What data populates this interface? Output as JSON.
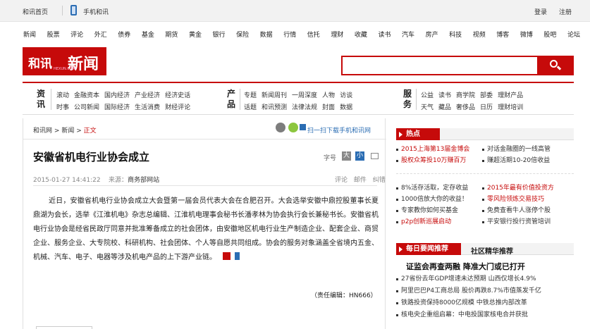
{
  "topbar": {
    "home": "和讯首页",
    "mobile": "手机和讯",
    "login": "登录",
    "register": "注册"
  },
  "nav": [
    "新闻",
    "股票",
    "评论",
    "外汇",
    "债券",
    "基金",
    "期货",
    "黄金",
    "银行",
    "保险",
    "数据",
    "行情",
    "信托",
    "理财",
    "收藏",
    "读书",
    "汽车",
    "房产",
    "科技",
    "视频",
    "博客",
    "微博",
    "股吧",
    "论坛"
  ],
  "logo": {
    "brand": "和讯",
    "channel": "新闻",
    "domain": "HEXUN.COM"
  },
  "search": {
    "value": "",
    "placeholder": ""
  },
  "channels": {
    "info": {
      "label": "资讯",
      "row1": [
        "滚动",
        "金融资本",
        "国内经济",
        "产业经济",
        "经济史话"
      ],
      "row2": [
        "时事",
        "公司新闻",
        "国际经济",
        "生活消费",
        "财经评论"
      ]
    },
    "product": {
      "label": "产品",
      "row1": [
        "专题",
        "新闻周刊",
        "一周深度",
        "人物",
        "访谈"
      ],
      "row2": [
        "话题",
        "和讯预测",
        "法律法规",
        "封面",
        "数据"
      ]
    },
    "service": {
      "label": "服务",
      "row1": [
        "公益",
        "读书",
        "商学院",
        "部委",
        "理财产品"
      ],
      "row2": [
        "天气",
        "藏品",
        "奢侈品",
        "日历",
        "理财培训"
      ]
    }
  },
  "breadcrumb": {
    "site": "和讯网",
    "section": "新闻",
    "current": "正文",
    "sep1": ">",
    "sep2": ">"
  },
  "qr_text": "扫一扫下载手机和讯网",
  "article": {
    "title": "安徽省机电行业协会成立",
    "font_label": "字号",
    "font_big": "大",
    "font_small": "小",
    "date": "2015-01-27 14:41:22",
    "source_label": "来源：",
    "source": "商务部网站",
    "comment": "评论",
    "mail": "邮件",
    "error": "纠错",
    "body": "近日，安徽省机电行业协会成立大会暨第一届会员代表大会在合肥召开。大会选举安徽中鼎控股董事长夏鼎湖为会长，选举《江淮机电》杂志总编辑、江淮机电理事会秘书长潘孝林为协会执行会长兼秘书长。安徽省机电行业协会是经省民政厅同意并批准筹备成立的社会团体，由安徽地区机电行业生产制造企业、配套企业、商贸企业、服务企业、大专院校、科研机构、社会团体、个人等自愿共同组成。协会的服务对象涵盖全省境内五金、机械、汽车、电子、电器等涉及机电产品的上下游产业链。",
    "editor": "（责任编辑：HN666）"
  },
  "sidebar": {
    "hot_title": "热点",
    "hot": [
      {
        "left": "2015上海第13届金博会",
        "left_red": true,
        "right": "对话金融圈的一线高管",
        "right_red": false
      },
      {
        "left": "股权众筹投10万赚百万",
        "left_red": true,
        "right": "赚超活期10-20倍收益",
        "right_red": false
      }
    ],
    "promo": [
      {
        "left": "8%活存活取，定存收益",
        "left_red": false,
        "right": "2015年最有价值投资方",
        "right_red": true
      },
      {
        "left": "1000倍放大你的收益！",
        "left_red": false,
        "right": "零风险领炼交易技巧",
        "right_red": true
      },
      {
        "left": "专家教你如何买基金",
        "left_red": false,
        "right": "免费查看牛人涨停个股",
        "right_red": false
      },
      {
        "left": "p2p创新巡展启动",
        "left_red": true,
        "right": "平安银行投行资管培训",
        "right_red": false
      }
    ],
    "daily_tab": "每日要闻推荐",
    "community_tab": "社区精华推荐",
    "headline": "证监会再查两融  降准大门或已打开",
    "news": [
      "27省份去年GDP增速未达预期 山西仅增长4.9%",
      "阿里巴巴P4工商总局 股价再跌8.7%市值蒸发千亿",
      "铁路投资保持8000亿规模 中铁总推内部改革",
      "核电央企重组启幕：中电投国家核电合并获批"
    ]
  }
}
